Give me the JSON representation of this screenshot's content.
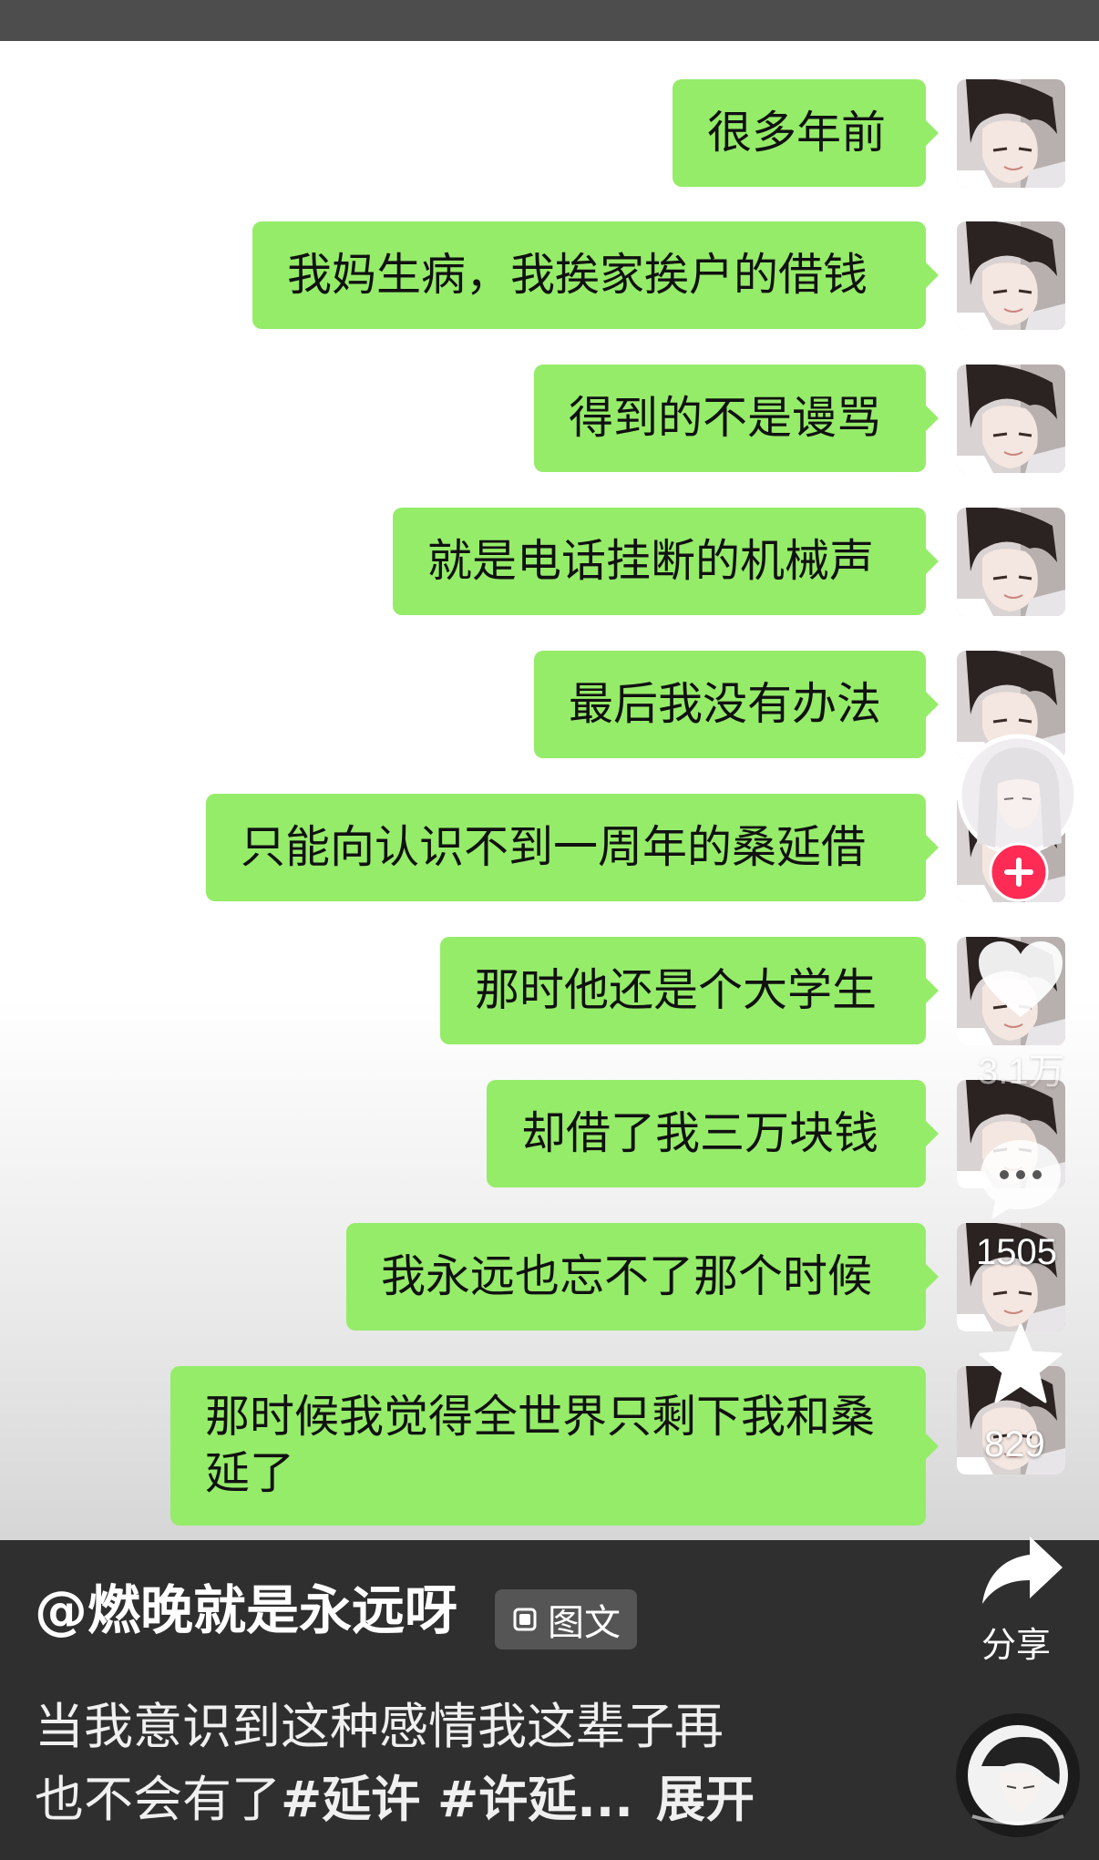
{
  "messages": [
    "很多年前",
    "我妈生病，我挨家挨户的借钱",
    "得到的不是谩骂",
    "就是电话挂断的机械声",
    "最后我没有办法",
    "只能向认识不到一周年的桑延借",
    "那时他还是个大学生",
    "却借了我三万块钱",
    "我永远也忘不了那个时候",
    "那时候我觉得全世界只剩下我和桑",
    "延了"
  ],
  "actions": {
    "like_count": "3.1万",
    "comment_count": "1505",
    "favorite_count": "829",
    "share_label": "分享",
    "follow_icon": "plus-icon"
  },
  "post": {
    "author": "@燃晚就是永远呀",
    "tag_label": "图文",
    "caption_line1": "当我意识到这种感情我这辈子再",
    "caption_line2_text": "也不会有了",
    "caption_hashtags": "#延许 #许延...",
    "expand_label": "展开"
  },
  "colors": {
    "bubble": "#95ec69",
    "topbar": "#4d4d4d",
    "bottom_panel": "#2f2f2f",
    "follow_button": "#fe2c55"
  }
}
